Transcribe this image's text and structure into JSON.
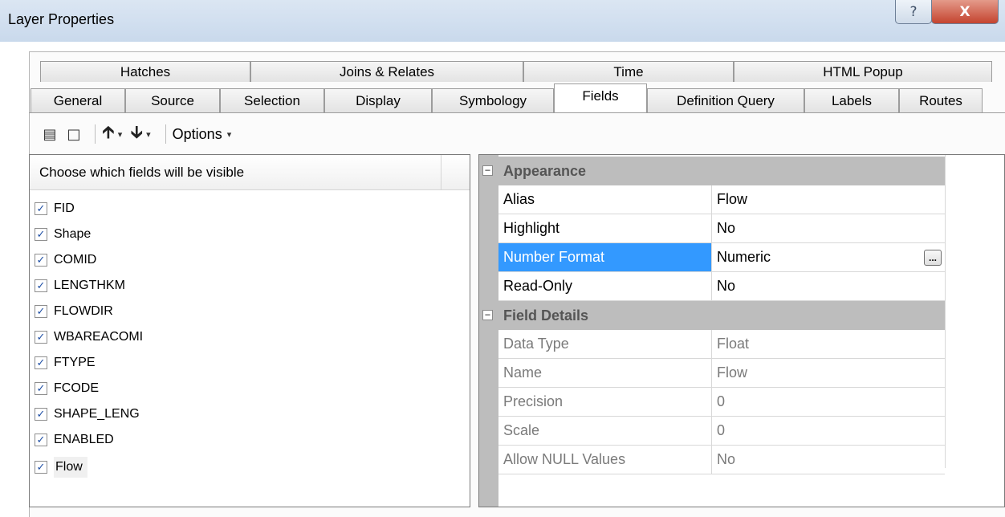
{
  "window": {
    "title": "Layer Properties",
    "help_glyph": "?",
    "close_glyph": "X"
  },
  "tabs": {
    "row1": [
      "Hatches",
      "Joins & Relates",
      "Time",
      "HTML Popup"
    ],
    "row2": [
      "General",
      "Source",
      "Selection",
      "Display",
      "Symbology",
      "Fields",
      "Definition Query",
      "Labels",
      "Routes"
    ],
    "active": "Fields"
  },
  "toolbar": {
    "options_label": "Options",
    "caret": "▾"
  },
  "fields_panel": {
    "header": "Choose which fields will be visible",
    "items": [
      {
        "label": "FID",
        "checked": true
      },
      {
        "label": "Shape",
        "checked": true
      },
      {
        "label": "COMID",
        "checked": true
      },
      {
        "label": "LENGTHKM",
        "checked": true
      },
      {
        "label": "FLOWDIR",
        "checked": true
      },
      {
        "label": "WBAREACOMI",
        "checked": true
      },
      {
        "label": "FTYPE",
        "checked": true
      },
      {
        "label": "FCODE",
        "checked": true
      },
      {
        "label": "SHAPE_LENG",
        "checked": true
      },
      {
        "label": "ENABLED",
        "checked": true
      },
      {
        "label": "Flow",
        "checked": true,
        "selected": true
      }
    ]
  },
  "property_grid": {
    "appearance": {
      "category": "Appearance",
      "toggle": "−",
      "rows": [
        {
          "name": "Alias",
          "value": "Flow"
        },
        {
          "name": "Highlight",
          "value": "No"
        },
        {
          "name": "Number Format",
          "value": "Numeric",
          "button": "..."
        },
        {
          "name": "Read-Only",
          "value": "No"
        }
      ]
    },
    "field_details": {
      "category": "Field Details",
      "toggle": "−",
      "rows": [
        {
          "name": "Data Type",
          "value": "Float"
        },
        {
          "name": "Name",
          "value": "Flow"
        },
        {
          "name": "Precision",
          "value": "0"
        },
        {
          "name": "Scale",
          "value": "0"
        },
        {
          "name": "Allow NULL Values",
          "value": "No"
        }
      ]
    }
  },
  "colors": {
    "selection_blue": "#3399ff",
    "category_gray": "#bdbdbd",
    "close_red": "#c4442f"
  }
}
